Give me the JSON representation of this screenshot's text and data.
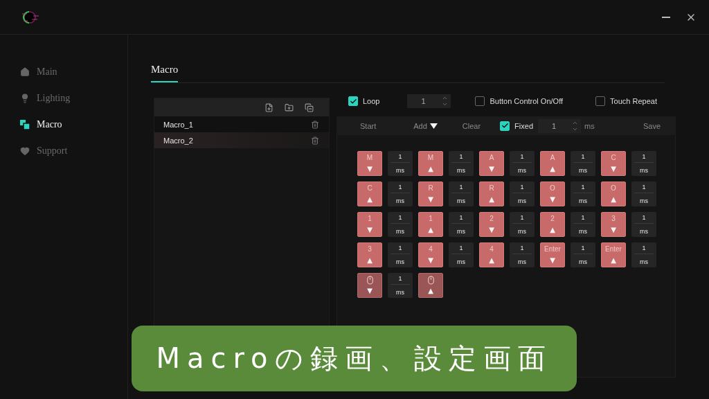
{
  "sidebar": {
    "items": [
      {
        "kind": "home",
        "label": "Main",
        "selected": false
      },
      {
        "kind": "bulb",
        "label": "Lighting",
        "selected": false
      },
      {
        "kind": "macro",
        "label": "Macro",
        "selected": true
      },
      {
        "kind": "heart",
        "label": "Support",
        "selected": false
      }
    ]
  },
  "tabs": [
    {
      "label": "Macro",
      "selected": true
    }
  ],
  "macro_list": {
    "items": [
      {
        "label": "Macro_1",
        "selected": false
      },
      {
        "label": "Macro_2",
        "selected": true
      }
    ]
  },
  "options": {
    "loop": {
      "label": "Loop",
      "checked": true,
      "value": "1"
    },
    "button_control": {
      "label": "Button Control On/Off",
      "checked": false
    },
    "touch_repeat": {
      "label": "Touch Repeat",
      "checked": false
    }
  },
  "toolbar": {
    "start": "Start",
    "add": "Add",
    "clear": "Clear",
    "fixed": {
      "label": "Fixed",
      "checked": true,
      "value": "1",
      "unit": "ms"
    },
    "save": "Save"
  },
  "events": [
    {
      "kind": "key",
      "label": "M",
      "arrow": "▼",
      "delay": "1",
      "unit": "ms"
    },
    {
      "kind": "key",
      "label": "M",
      "arrow": "▲",
      "delay": "1",
      "unit": "ms"
    },
    {
      "kind": "key",
      "label": "A",
      "arrow": "▼",
      "delay": "1",
      "unit": "ms"
    },
    {
      "kind": "key",
      "label": "A",
      "arrow": "▲",
      "delay": "1",
      "unit": "ms"
    },
    {
      "kind": "key",
      "label": "C",
      "arrow": "▼",
      "delay": "1",
      "unit": "ms"
    },
    {
      "kind": "key",
      "label": "C",
      "arrow": "▲",
      "delay": "1",
      "unit": "ms"
    },
    {
      "kind": "key",
      "label": "R",
      "arrow": "▼",
      "delay": "1",
      "unit": "ms"
    },
    {
      "kind": "key",
      "label": "R",
      "arrow": "▲",
      "delay": "1",
      "unit": "ms"
    },
    {
      "kind": "key",
      "label": "O",
      "arrow": "▼",
      "delay": "1",
      "unit": "ms"
    },
    {
      "kind": "key",
      "label": "O",
      "arrow": "▲",
      "delay": "1",
      "unit": "ms"
    },
    {
      "kind": "key",
      "label": "1",
      "arrow": "▼",
      "delay": "1",
      "unit": "ms"
    },
    {
      "kind": "key",
      "label": "1",
      "arrow": "▲",
      "delay": "1",
      "unit": "ms"
    },
    {
      "kind": "key",
      "label": "2",
      "arrow": "▼",
      "delay": "1",
      "unit": "ms"
    },
    {
      "kind": "key",
      "label": "2",
      "arrow": "▲",
      "delay": "1",
      "unit": "ms"
    },
    {
      "kind": "key",
      "label": "3",
      "arrow": "▼",
      "delay": "1",
      "unit": "ms"
    },
    {
      "kind": "key",
      "label": "3",
      "arrow": "▲",
      "delay": "1",
      "unit": "ms"
    },
    {
      "kind": "key",
      "label": "4",
      "arrow": "▼",
      "delay": "1",
      "unit": "ms"
    },
    {
      "kind": "key",
      "label": "4",
      "arrow": "▲",
      "delay": "1",
      "unit": "ms"
    },
    {
      "kind": "key",
      "label": "Enter",
      "arrow": "▼",
      "delay": "1",
      "unit": "ms"
    },
    {
      "kind": "key",
      "label": "Enter",
      "arrow": "▲",
      "delay": "1",
      "unit": "ms"
    },
    {
      "kind": "mouse",
      "arrow": "▼",
      "delay": "1",
      "unit": "ms"
    },
    {
      "kind": "mouse",
      "arrow": "▲"
    }
  ],
  "caption": "Macroの録画、設定画面"
}
